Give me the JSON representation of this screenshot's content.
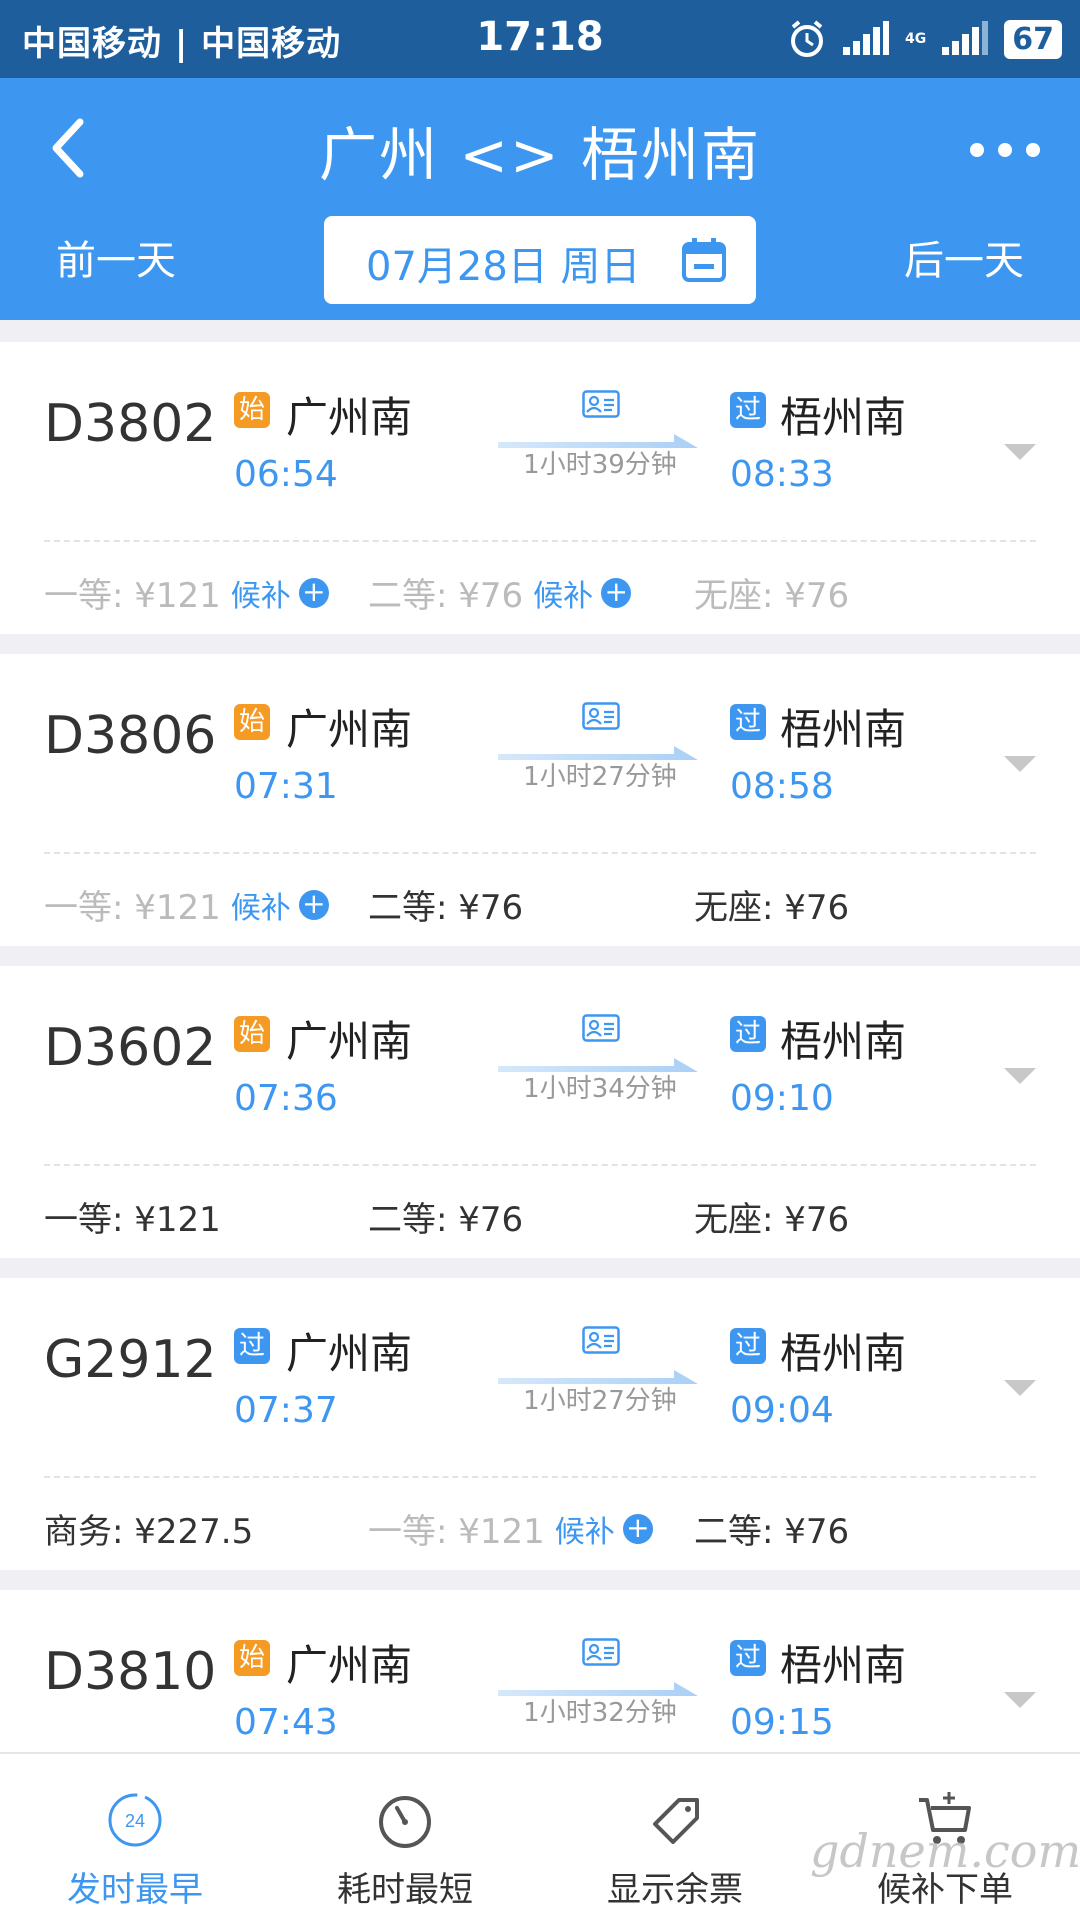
{
  "status_bar": {
    "carrier": "中国移动 | 中国移动",
    "time": "17:18",
    "network_label": "4G",
    "battery": "67"
  },
  "header": {
    "title": "广州 <> 梧州南",
    "prev_day": "前一天",
    "next_day": "后一天",
    "date": "07月28日 周日"
  },
  "trains": [
    {
      "number": "D3802",
      "dep_badge": "始",
      "dep_badge_type": "start",
      "dep_station": "广州南",
      "dep_time": "06:54",
      "arr_badge": "过",
      "arr_station": "梧州南",
      "arr_time": "08:33",
      "duration": "1小时39分钟",
      "seats": [
        {
          "label": "一等: ¥121",
          "waitlist": "候补",
          "soldout": true
        },
        {
          "label": "二等: ¥76",
          "waitlist": "候补",
          "soldout": true
        },
        {
          "label": "无座: ¥76",
          "waitlist": "",
          "soldout": true
        }
      ]
    },
    {
      "number": "D3806",
      "dep_badge": "始",
      "dep_badge_type": "start",
      "dep_station": "广州南",
      "dep_time": "07:31",
      "arr_badge": "过",
      "arr_station": "梧州南",
      "arr_time": "08:58",
      "duration": "1小时27分钟",
      "seats": [
        {
          "label": "一等: ¥121",
          "waitlist": "候补",
          "soldout": true
        },
        {
          "label": "二等: ¥76",
          "waitlist": "",
          "soldout": false
        },
        {
          "label": "无座: ¥76",
          "waitlist": "",
          "soldout": false
        }
      ]
    },
    {
      "number": "D3602",
      "dep_badge": "始",
      "dep_badge_type": "start",
      "dep_station": "广州南",
      "dep_time": "07:36",
      "arr_badge": "过",
      "arr_station": "梧州南",
      "arr_time": "09:10",
      "duration": "1小时34分钟",
      "seats": [
        {
          "label": "一等: ¥121",
          "waitlist": "",
          "soldout": false
        },
        {
          "label": "二等: ¥76",
          "waitlist": "",
          "soldout": false
        },
        {
          "label": "无座: ¥76",
          "waitlist": "",
          "soldout": false
        }
      ]
    },
    {
      "number": "G2912",
      "dep_badge": "过",
      "dep_badge_type": "pass",
      "dep_station": "广州南",
      "dep_time": "07:37",
      "arr_badge": "过",
      "arr_station": "梧州南",
      "arr_time": "09:04",
      "duration": "1小时27分钟",
      "seats": [
        {
          "label": "商务:  ¥227.5",
          "waitlist": "",
          "soldout": false
        },
        {
          "label": "一等: ¥121",
          "waitlist": "候补",
          "soldout": true
        },
        {
          "label": "二等: ¥76",
          "waitlist": "",
          "soldout": false
        }
      ]
    },
    {
      "number": "D3810",
      "dep_badge": "始",
      "dep_badge_type": "start",
      "dep_station": "广州南",
      "dep_time": "07:43",
      "arr_badge": "过",
      "arr_station": "梧州南",
      "arr_time": "09:15",
      "duration": "1小时32分钟",
      "seats": []
    }
  ],
  "bottom_nav": [
    {
      "label": "发时最早",
      "icon": "clock-24-icon",
      "active": true,
      "icon_text": "24"
    },
    {
      "label": "耗时最短",
      "icon": "stopwatch-icon",
      "active": false
    },
    {
      "label": "显示余票",
      "icon": "ticket-tag-icon",
      "active": false
    },
    {
      "label": "候补下单",
      "icon": "cart-add-icon",
      "active": false
    }
  ],
  "watermark": "gdnem.com",
  "colors": {
    "status_bar": "#1f5e9c",
    "header": "#3d97f0",
    "start_badge": "#f59a23",
    "pass_badge": "#3d97f0"
  }
}
